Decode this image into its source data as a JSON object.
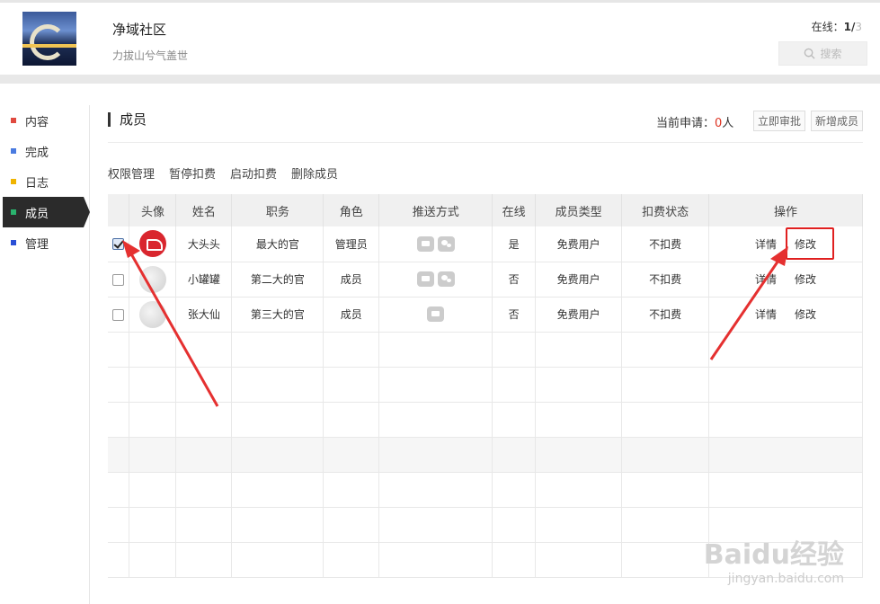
{
  "header": {
    "title": "净域社区",
    "subtitle": "力拔山兮气盖世",
    "online_label": "在线：",
    "online_current": "1/",
    "online_total": "3",
    "search_label": "搜索"
  },
  "sidebar": {
    "items": [
      {
        "label": "内容",
        "color": "#e04a3f"
      },
      {
        "label": "完成",
        "color": "#4a7be0"
      },
      {
        "label": "日志",
        "color": "#f0b400"
      },
      {
        "label": "成员",
        "color": "#2ab36e",
        "active": true
      },
      {
        "label": "管理",
        "color": "#2a4fd6"
      }
    ]
  },
  "main": {
    "section_title": "成员",
    "apply_label": "当前申请：",
    "apply_count": "0",
    "apply_unit": "人",
    "approve_button": "立即审批",
    "add_button": "新增成员",
    "actions": [
      "权限管理",
      "暂停扣费",
      "启动扣费",
      "删除成员"
    ]
  },
  "table": {
    "headers": [
      "",
      "头像",
      "姓名",
      "职务",
      "角色",
      "推送方式",
      "在线",
      "成员类型",
      "扣费状态",
      "操作"
    ],
    "rows": [
      {
        "checked": true,
        "avatar": "red",
        "name": "大头头",
        "position": "最大的官",
        "role": "管理员",
        "push": [
          "msg",
          "wx"
        ],
        "online": "是",
        "type": "免费用户",
        "fee": "不扣费",
        "detail": "详情",
        "edit": "修改"
      },
      {
        "checked": false,
        "avatar": "grey",
        "name": "小罐罐",
        "position": "第二大的官",
        "role": "成员",
        "push": [
          "msg",
          "wx"
        ],
        "online": "否",
        "type": "免费用户",
        "fee": "不扣费",
        "detail": "详情",
        "edit": "修改"
      },
      {
        "checked": false,
        "avatar": "grey",
        "name": "张大仙",
        "position": "第三大的官",
        "role": "成员",
        "push": [
          "msg"
        ],
        "online": "否",
        "type": "免费用户",
        "fee": "不扣费",
        "detail": "详情",
        "edit": "修改"
      }
    ]
  },
  "watermark": {
    "brand": "Baidu经验",
    "url": "jingyan.baidu.com"
  }
}
